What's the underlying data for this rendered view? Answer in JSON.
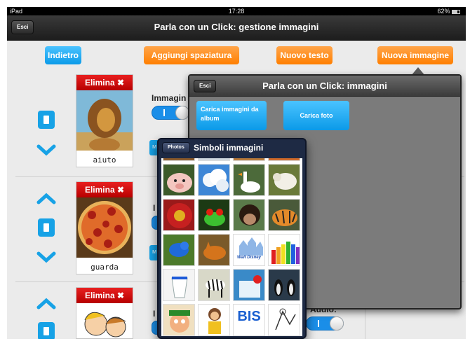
{
  "status_bar": {
    "device": "iPad",
    "time": "17:28",
    "battery": "62%"
  },
  "main": {
    "exit_label": "Esci",
    "title": "Parla con un Click: gestione immagini",
    "buttons": {
      "back": "Indietro",
      "add_spacing": "Aggiungi spaziatura",
      "new_text": "Nuovo testo",
      "new_image": "Nuova immagine"
    },
    "items": [
      {
        "delete_label": "Elimina",
        "caption": "aiuto",
        "image": "lion-picture"
      },
      {
        "delete_label": "Elimina",
        "caption": "guarda",
        "image": "pizza-picture"
      },
      {
        "delete_label": "Elimina",
        "caption": "",
        "image": "children-cartoon-picture"
      }
    ],
    "partial_labels": {
      "row1_image_label": "Immagin",
      "row2_fragment": "I",
      "row3_fragment": "I",
      "row3_audio_label": "Audio:"
    },
    "mini_button_label": "M"
  },
  "image_modal": {
    "exit_label": "Esci",
    "title": "Parla con un Click: immagini",
    "album_button": "Carica immagini da album",
    "photo_button": "Carica foto"
  },
  "symbols_popover": {
    "back_label": "Photos",
    "title": "Simboli immagini",
    "tiles": [
      "pig-photo",
      "clouds-photo",
      "goose-photo",
      "lamb-photo",
      "flower-photo",
      "frog-photo",
      "chimpanzee-photo",
      "tiger-photo",
      "bird-photo",
      "fox-photo",
      "castle-logo",
      "crayons-photo",
      "yogurt-photo",
      "zebra-photo",
      "ice-photo",
      "penguins-photo",
      "cartoon-photo",
      "boy-cartoon-photo",
      "brand-logo",
      "sketch-photo"
    ],
    "disney_word": "Walt Disney",
    "bis_word": "BIS"
  },
  "colors": {
    "accent_blue": "#17a2e6",
    "accent_orange": "#ff8a10",
    "delete_red": "#d41010"
  }
}
